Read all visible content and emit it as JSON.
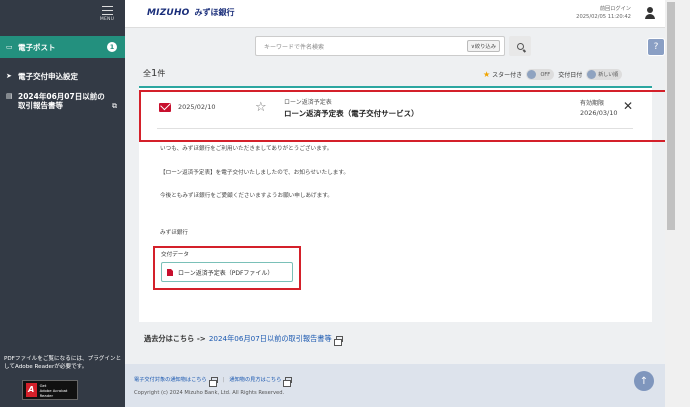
{
  "sidebar": {
    "menu_label": "MENU",
    "items": [
      {
        "label": "電子ポスト",
        "badge": "1"
      },
      {
        "label": "電子交付申込設定"
      },
      {
        "label": "2024年06月07日以前の取引報告書等"
      }
    ],
    "note": "PDFファイルをご覧になるには、プラグインとしてAdobe Readerが必要です。",
    "adobe": {
      "line1": "Get",
      "line2": "Adobe Acrobat Reader"
    }
  },
  "header": {
    "logo_en": "MIZUHO",
    "logo_ja": "みずほ銀行",
    "last_login_label": "前回ログイン",
    "last_login_time": "2025/02/05 11:20:42"
  },
  "search": {
    "placeholder": "キーワードで件名検索",
    "filter_label": "∨絞り込み"
  },
  "list": {
    "count_prefix": "全",
    "count": "1",
    "count_suffix": "件",
    "star_filter_label": "スター付き",
    "toggle_off": "OFF",
    "sort_label": "交付日付",
    "sort_value": "新しい順"
  },
  "message": {
    "date": "2025/02/10",
    "category": "ローン返済予定表",
    "title": "ローン返済予定表（電子交付サービス）",
    "expiry_label": "有効期限",
    "expiry_date": "2026/03/10",
    "body": [
      "いつも、みずほ銀行をご利用いただきましてありがとうございます。",
      "【ローン返済予定表】を電子交付いたしましたので、お知らせいたします。",
      "今後ともみずほ銀行をご愛顧くださいますようお願い申しあげます。",
      "みずほ銀行"
    ],
    "attachment_label": "交付データ",
    "attachment_file": "ローン返済予定表（PDFファイル）"
  },
  "past": {
    "label": "過去分はこちら ->",
    "link": "2024年06月07日以前の取引報告書等"
  },
  "footer": {
    "link1": "電子交付対象の通知物はこちら",
    "link2": "通知物の見方はこちら",
    "copyright": "Copyright (c) 2024 Mizuho Bank, Ltd. All Rights Reserved."
  }
}
